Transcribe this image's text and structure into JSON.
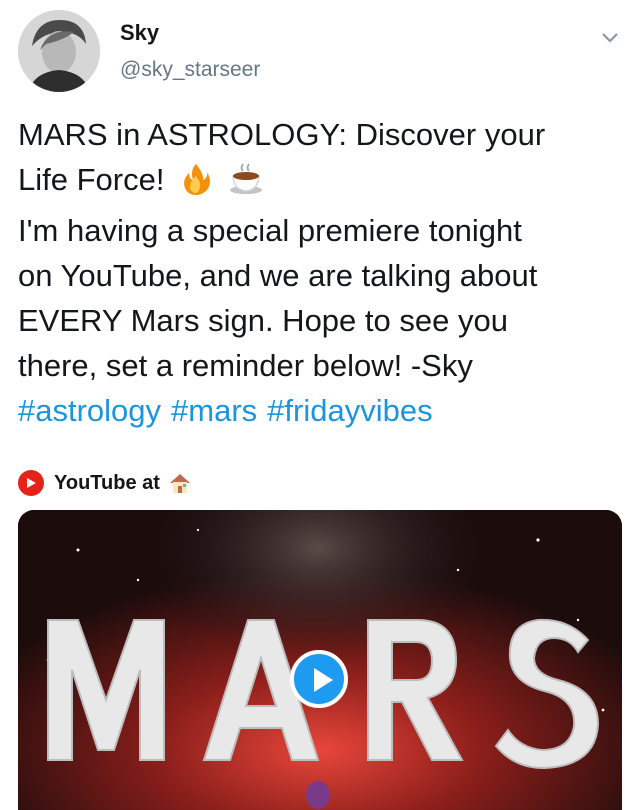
{
  "user": {
    "name": "Sky",
    "handle": "@sky_starseer"
  },
  "tweet": {
    "lines": [
      "MARS in ASTROLOGY: Discover your",
      "Life Force!",
      "I'm having a special premiere tonight",
      "on YouTube, and we are talking about",
      "EVERY Mars sign. Hope to see you",
      "there, set a reminder below! -Sky"
    ],
    "hashtags": [
      "#astrology",
      "#mars",
      "#fridayvibes"
    ],
    "emojis": [
      "fire-emoji",
      "coffee-emoji"
    ]
  },
  "source": {
    "label": "YouTube at",
    "icon": "house-icon"
  },
  "card": {
    "title": "MARS",
    "play_icon": "play-icon"
  },
  "colors": {
    "link": "#1b95e0",
    "secondary": "#657786",
    "youtube": "#e62117",
    "play": "#1d9bf0"
  }
}
